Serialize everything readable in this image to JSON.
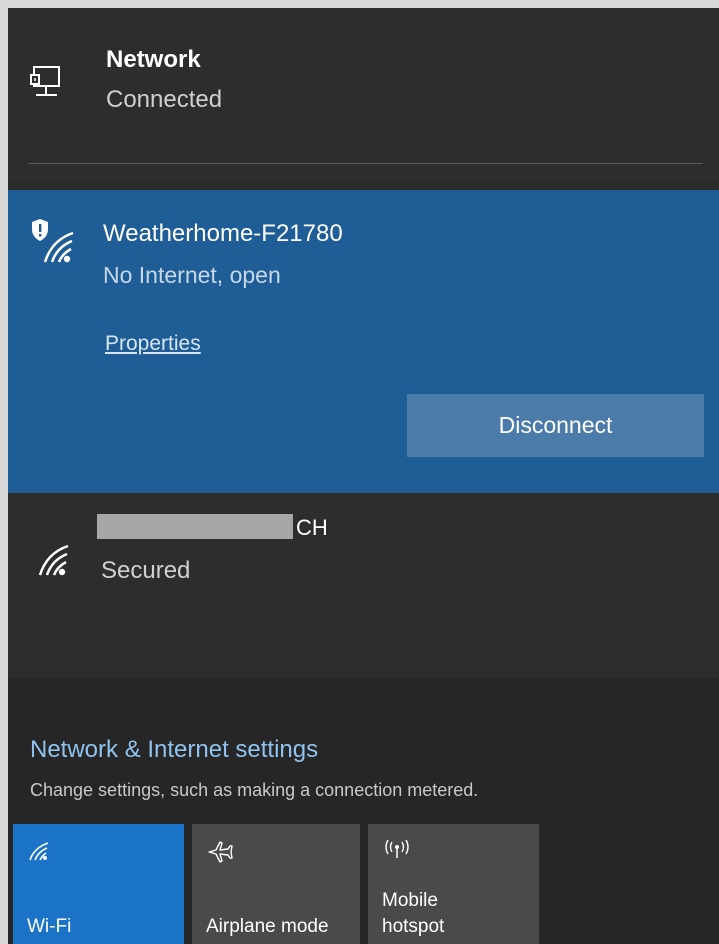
{
  "network_header": {
    "title": "Network",
    "status": "Connected",
    "icon": "ethernet-pc-icon"
  },
  "selected_network": {
    "name": "Weatherhome-F21780",
    "status": "No Internet, open",
    "properties_label": "Properties",
    "disconnect_label": "Disconnect",
    "icon": "wifi-shield-icon",
    "background": "#1f5d96"
  },
  "other_network": {
    "name_visible_suffix": "CH",
    "status": "Secured",
    "icon": "wifi-icon"
  },
  "settings": {
    "link_label": "Network & Internet settings",
    "description": "Change settings, such as making a connection metered."
  },
  "quick_actions": [
    {
      "label": "Wi-Fi",
      "icon": "wifi-icon",
      "active": true,
      "color": "#1b73c8"
    },
    {
      "label": "Airplane mode",
      "icon": "airplane-icon",
      "active": false,
      "color": "#4a4a4a"
    },
    {
      "label": "Mobile\nhotspot",
      "label_line1": "Mobile",
      "label_line2": "hotspot",
      "icon": "hotspot-icon",
      "active": false,
      "color": "#4a4a4a"
    }
  ],
  "colors": {
    "accent_link": "#8fc3ee",
    "panel_bg": "#2b2b2b"
  }
}
